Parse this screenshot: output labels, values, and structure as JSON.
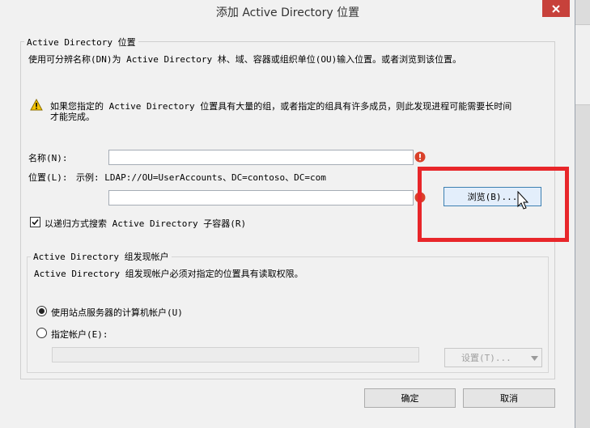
{
  "window": {
    "title": "添加 Active Directory 位置",
    "close_icon": "close-icon"
  },
  "location_group": {
    "label": "Active Directory 位置",
    "description": "使用可分辨名称(DN)为 Active Directory 林、域、容器或组织单位(OU)输入位置。或者浏览到该位置。",
    "warning_line1": "如果您指定的 Active Directory 位置具有大量的组，或者指定的组具有许多成员，则此发现进程可能需要长时间",
    "warning_line2": "才能完成。",
    "name_label": "名称(N):",
    "name_value": "",
    "location_label": "位置(L):",
    "example_text": "示例: LDAP://OU=UserAccounts、DC=contoso、DC=com",
    "location_value": "",
    "browse_button": "浏览(B)...",
    "recursive_checkbox_label": "以递归方式搜索 Active Directory 子容器(R)",
    "recursive_checked": true
  },
  "account_group": {
    "label": "Active Directory 组发现帐户",
    "description": "Active Directory 组发现帐户必须对指定的位置具有读取权限。",
    "radio_computer_account": "使用站点服务器的计算机帐户(U)",
    "radio_specify_account": "指定帐户(E):",
    "selected": "computer_account",
    "account_value": "",
    "settings_button": "设置(T)..."
  },
  "footer": {
    "ok_button": "确定",
    "cancel_button": "取消"
  },
  "colors": {
    "highlight_red": "#e8262a",
    "close_red": "#c7413b",
    "warning_yellow": "#f5c400",
    "error_red": "#d9412a"
  }
}
